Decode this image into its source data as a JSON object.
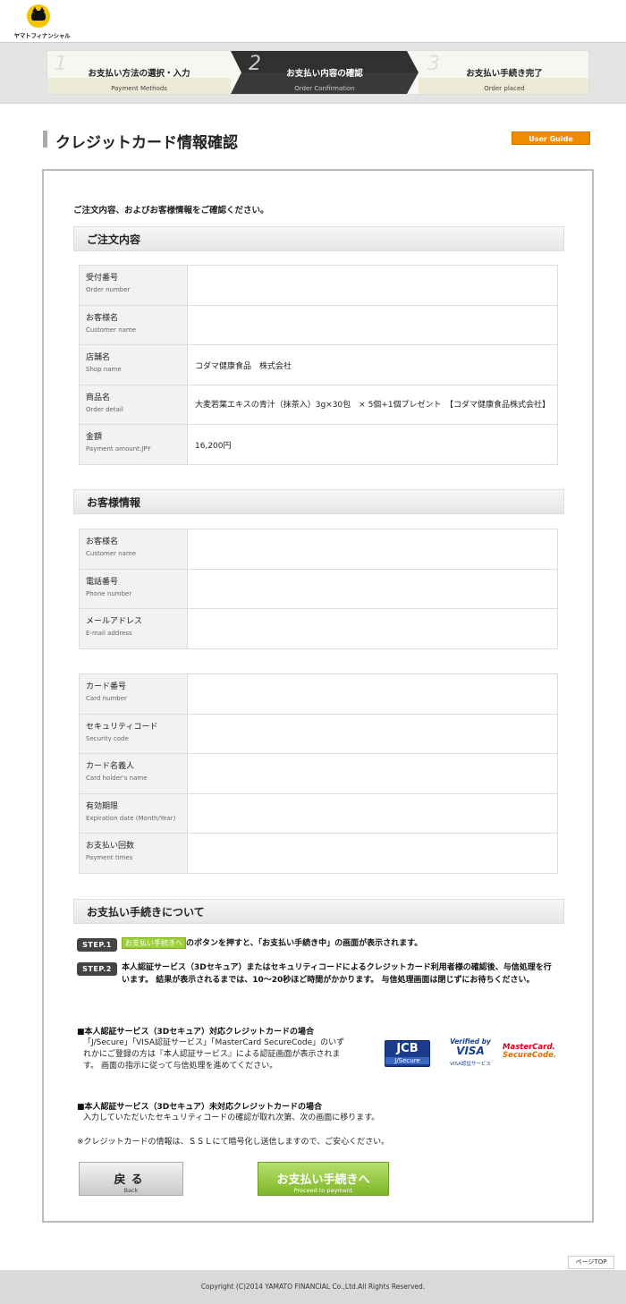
{
  "brand": {
    "logo_text": "ヤマトフィナンシャル"
  },
  "steps": [
    {
      "num": "1",
      "title": "お支払い方法の選択・入力",
      "subtitle": "Payment Methods"
    },
    {
      "num": "2",
      "title": "お支払い内容の確認",
      "subtitle": "Order Confirmation"
    },
    {
      "num": "3",
      "title": "お支払い手続き完了",
      "subtitle": "Order placed"
    }
  ],
  "page": {
    "title": "クレジットカード情報確認",
    "guide_button": "User Guide (English)",
    "intro": "ご注文内容、およびお客様情報をご確認ください。"
  },
  "order": {
    "heading": "ご注文内容",
    "rows": [
      {
        "jp": "受付番号",
        "en": "Order number",
        "value": ""
      },
      {
        "jp": "お客様名",
        "en": "Customer name",
        "value": ""
      },
      {
        "jp": "店舗名",
        "en": "Shop name",
        "value": "コダマ健康食品　株式会社"
      },
      {
        "jp": "商品名",
        "en": "Order detail",
        "value": "大麦若葉エキスの青汁（抹茶入）3g×30包　× 5個+1個プレゼント　【コダマ健康食品株式会社】"
      },
      {
        "jp": "金額",
        "en": "Payment amount:JPY",
        "value": "16,200円"
      }
    ]
  },
  "customer": {
    "heading": "お客様情報",
    "rows": [
      {
        "jp": "お客様名",
        "en": "Customer name",
        "value": ""
      },
      {
        "jp": "電話番号",
        "en": "Phone number",
        "value": ""
      },
      {
        "jp": "メールアドレス",
        "en": "E-mail address",
        "value": ""
      }
    ]
  },
  "card": {
    "rows": [
      {
        "jp": "カード番号",
        "en": "Card number",
        "value": ""
      },
      {
        "jp": "セキュリティコード",
        "en": "Security code",
        "value": ""
      },
      {
        "jp": "カード名義人",
        "en": "Card holder's name",
        "value": ""
      },
      {
        "jp": "有効期限",
        "en": "Expiration date (Month/Year)",
        "value": ""
      },
      {
        "jp": "お支払い回数",
        "en": "Payment times",
        "value": ""
      }
    ]
  },
  "procedure": {
    "heading": "お支払い手続きについて",
    "step1_badge": "STEP.1",
    "step1_inline_button": "お支払い手続きへ",
    "step1_text": "のボタンを押すと、「お支払い手続き中」の画面が表示されます。",
    "step2_badge": "STEP.2",
    "step2_text": "本人認証サービス（3Dセキュア）またはセキュリティコードによるクレジットカード利用者様の確認後、与信処理を行います。 結果が表示されるまでは、10〜20秒ほど時間がかかります。 与信処理画面は閉じずにお待ちください。",
    "note1_heading": "■本人認証サービス（3Dセキュア）対応クレジットカードの場合",
    "note1_text": "「J/Secure」「VISA認証サービス」「MasterCard SecureCode」のいずれかにご登録の方は『本人認証サービス』による認証画面が表示されます。 画面の指示に従って与信処理を進めてください。",
    "note2_heading": "■本人認証サービス（3Dセキュア）未対応クレジットカードの場合",
    "note2_text": "入力していただいたセキュリティコードの確認が取れ次第、次の画面に移ります。",
    "ssl_note": "※クレジットカードの情報は、ＳＳＬにて暗号化し送信しますので、ご安心ください。"
  },
  "logos": {
    "jcb_top": "JCB",
    "jcb_bottom": "J/Secure",
    "visa_top": "Verified by",
    "visa_mid": "VISA",
    "visa_bottom": "VISA認証サービス",
    "mc_top": "MasterCard.",
    "mc_bottom": "SecureCode."
  },
  "buttons": {
    "back_jp": "戻る",
    "back_en": "Back",
    "proceed_jp": "お支払い手続きへ",
    "proceed_en": "Proceed to payment"
  },
  "pagetop": "ページTOP",
  "footer": "Copyright (C)2014 YAMATO FINANCIAL Co.,Ltd.All Rights Reserved.",
  "colors": {
    "accent_orange": "#f08c00",
    "proceed_green": "#8cc63f",
    "step_active": "#333333"
  }
}
